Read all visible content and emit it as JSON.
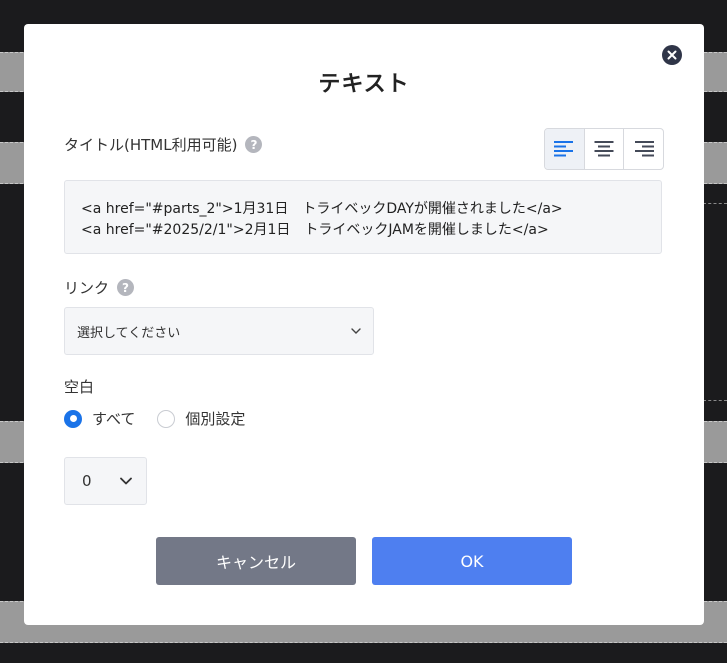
{
  "modal": {
    "title": "テキスト",
    "close_icon": "close-icon"
  },
  "title_field": {
    "label": "タイトル(HTML利用可能)",
    "help": "?",
    "lines": [
      "<a href=\"#parts_2\">1月31日　トライベックDAYが開催されました</a>",
      "<a href=\"#2025/2/1\">2月1日　トライベックJAMを開催しました</a>"
    ]
  },
  "alignment": {
    "selected": "left",
    "options": [
      "align-left-icon",
      "align-center-icon",
      "align-right-icon"
    ]
  },
  "link_field": {
    "label": "リンク",
    "help": "?",
    "value": "選択してください"
  },
  "spacing": {
    "label": "空白",
    "options": [
      {
        "label": "すべて",
        "checked": true
      },
      {
        "label": "個別設定",
        "checked": false
      }
    ],
    "value": "0"
  },
  "buttons": {
    "cancel": "キャンセル",
    "ok": "OK"
  },
  "colors": {
    "accent": "#4e7ff0",
    "radio_checked": "#1a73e8",
    "cancel_button": "#737887",
    "close_button": "#2f3548"
  }
}
